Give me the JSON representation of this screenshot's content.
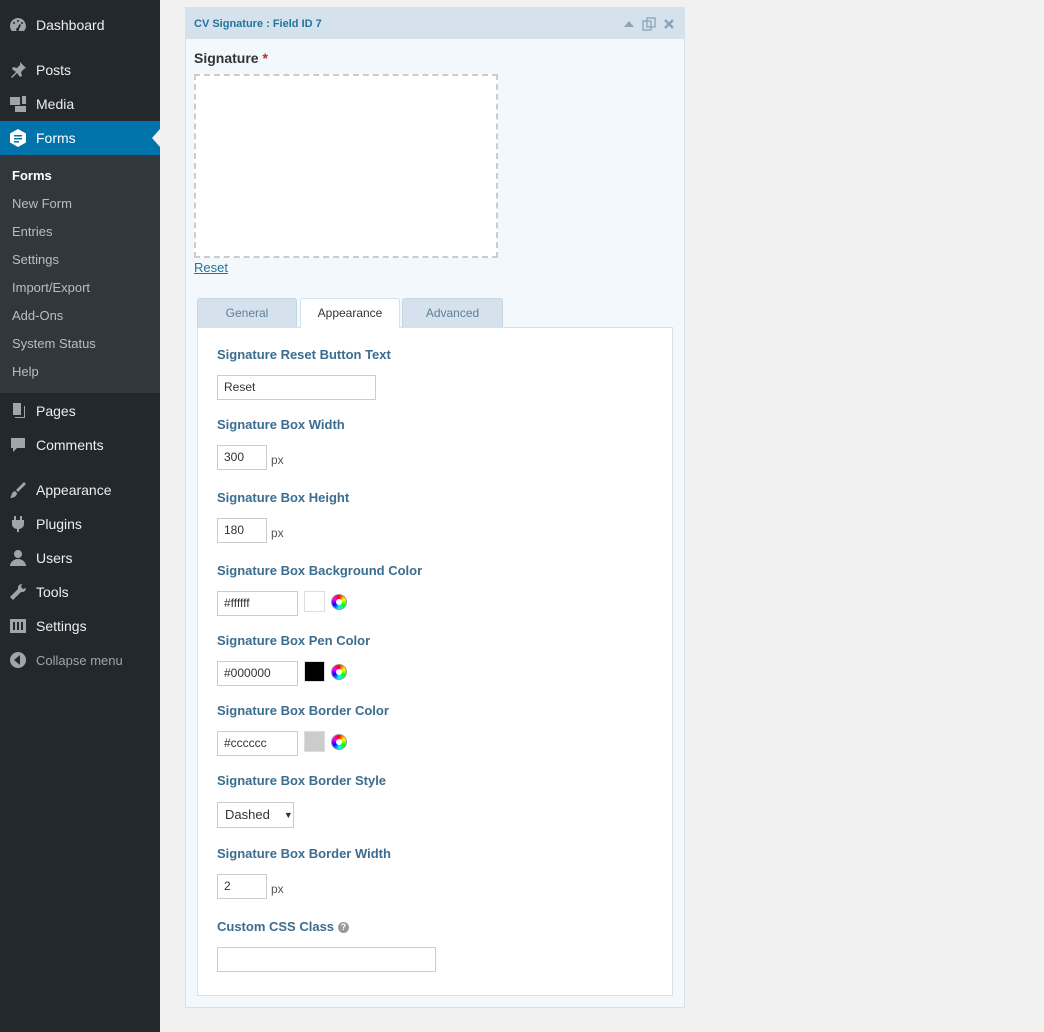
{
  "sidebar": {
    "items": [
      {
        "label": "Dashboard",
        "icon": "dashboard-icon"
      },
      {
        "label": "Posts",
        "icon": "pin-icon"
      },
      {
        "label": "Media",
        "icon": "media-icon"
      },
      {
        "label": "Forms",
        "icon": "forms-icon"
      },
      {
        "label": "Pages",
        "icon": "pages-icon"
      },
      {
        "label": "Comments",
        "icon": "comment-icon"
      },
      {
        "label": "Appearance",
        "icon": "brush-icon"
      },
      {
        "label": "Plugins",
        "icon": "plugin-icon"
      },
      {
        "label": "Users",
        "icon": "user-icon"
      },
      {
        "label": "Tools",
        "icon": "wrench-icon"
      },
      {
        "label": "Settings",
        "icon": "settings-icon"
      },
      {
        "label": "Collapse menu",
        "icon": "collapse-icon"
      }
    ],
    "submenu": [
      "Forms",
      "New Form",
      "Entries",
      "Settings",
      "Import/Export",
      "Add-Ons",
      "System Status",
      "Help"
    ]
  },
  "panel": {
    "title": "CV Signature : Field ID 7",
    "signature_label": "Signature",
    "required_mark": "*",
    "reset_link": "Reset"
  },
  "tabs": [
    "General",
    "Appearance",
    "Advanced"
  ],
  "settings": {
    "reset_text_label": "Signature Reset Button Text",
    "reset_text_value": "Reset",
    "width_label": "Signature Box Width",
    "width_value": "300",
    "height_label": "Signature Box Height",
    "height_value": "180",
    "px_unit": "px",
    "bg_color_label": "Signature Box Background Color",
    "bg_color_value": "#ffffff",
    "pen_color_label": "Signature Box Pen Color",
    "pen_color_value": "#000000",
    "border_color_label": "Signature Box Border Color",
    "border_color_value": "#cccccc",
    "border_style_label": "Signature Box Border Style",
    "border_style_value": "Dashed",
    "border_width_label": "Signature Box Border Width",
    "border_width_value": "2",
    "css_class_label": "Custom CSS Class",
    "css_class_value": ""
  },
  "colors": {
    "sidebar_bg": "#23282d",
    "submenu_bg": "#32373c",
    "active_bg": "#0073aa",
    "label_color": "#3b6d91",
    "link_color": "#21759b"
  }
}
